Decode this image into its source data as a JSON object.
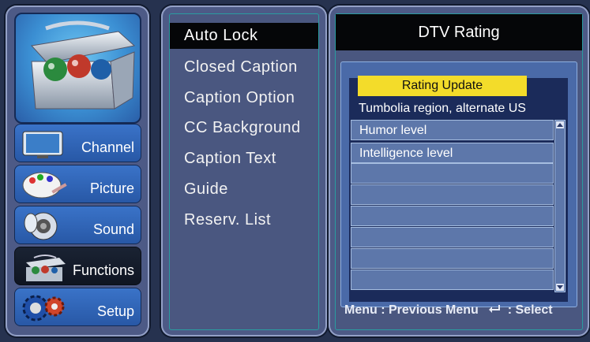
{
  "sidebar": {
    "items": [
      {
        "label": "Channel",
        "icon": "tv-icon"
      },
      {
        "label": "Picture",
        "icon": "palette-icon"
      },
      {
        "label": "Sound",
        "icon": "speaker-icon"
      },
      {
        "label": "Functions",
        "icon": "toolbox-icon"
      },
      {
        "label": "Setup",
        "icon": "gears-icon"
      }
    ],
    "active": "Functions"
  },
  "menu": {
    "items": [
      {
        "label": "Auto Lock"
      },
      {
        "label": "Closed Caption"
      },
      {
        "label": "Caption Option"
      },
      {
        "label": "CC Background"
      },
      {
        "label": "Caption Text"
      },
      {
        "label": "Guide"
      },
      {
        "label": "Reserv. List"
      }
    ],
    "selected": "Auto Lock"
  },
  "dtv": {
    "title": "DTV Rating",
    "update_button": "Rating Update",
    "region": "Tumbolia region, alternate US",
    "rows": [
      "Humor level",
      "Intelligence level",
      "",
      "",
      "",
      "",
      "",
      ""
    ]
  },
  "footer": {
    "menu_key": "Menu",
    "menu_action": ": Previous Menu",
    "select_action": ": Select"
  },
  "colors": {
    "background": "#26324f",
    "panel": "#4d5a86",
    "highlight": "#f3dc2a",
    "selection": "#050608"
  }
}
